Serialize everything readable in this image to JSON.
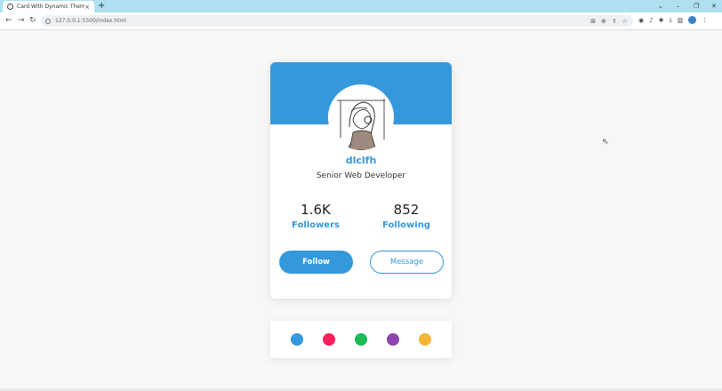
{
  "browser": {
    "tab_title": "Card With Dynamic Themes",
    "tab_close": "×",
    "new_tab": "+",
    "url": "127.0.0.1:5500/index.html",
    "window_controls": [
      "⌄",
      "–",
      "❐",
      "✕"
    ]
  },
  "card": {
    "username": "dlclfh",
    "role": "Senior Web Developer",
    "stats": [
      {
        "value": "1.6K",
        "label": "Followers"
      },
      {
        "value": "852",
        "label": "Following"
      }
    ],
    "follow_label": "Follow",
    "message_label": "Message"
  },
  "themes": [
    {
      "name": "blue",
      "color": "#3498db"
    },
    {
      "name": "pink",
      "color": "#ff1f5a"
    },
    {
      "name": "green",
      "color": "#1db954"
    },
    {
      "name": "purple",
      "color": "#8e44ad"
    },
    {
      "name": "orange",
      "color": "#f4b63a"
    }
  ],
  "colors": {
    "accent": "#3498db",
    "page_background": "#f7f7f7",
    "browser_frame": "#aee0ef"
  }
}
